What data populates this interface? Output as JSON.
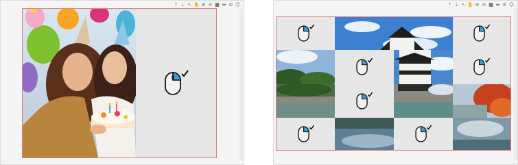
{
  "toolbar_icons": [
    "scroll-up-icon",
    "scroll-down-icon",
    "zoom-cursor-icon",
    "hand-pan-icon",
    "zoom-in-icon",
    "zoom-out-icon",
    "grid-icon",
    "fit-icon",
    "settings-icon",
    "info-icon"
  ],
  "colors": {
    "canvas_border": "#e07b7b",
    "mouse_highlight": "#3aa0d8",
    "panel_bg": "#f4f4f4",
    "canvas_bg": "#e6e6e6"
  },
  "left_panel": {
    "photo": "birthday-photo-two-women-cake-balloons",
    "placeholder_icon": "mouse-click-icon"
  },
  "right_panel": {
    "grid": [
      [
        "mouse-click-icon",
        "castle-photo",
        "castle-photo",
        "mouse-click-icon"
      ],
      [
        "trees-photo",
        "mouse-click-icon",
        "castle-photo",
        "mouse-click-icon"
      ],
      [
        "trees-photo",
        "mouse-click-icon",
        "castle-photo",
        "autumn-photo"
      ],
      [
        "mouse-click-icon",
        "water-photo",
        "mouse-click-icon",
        "water-photo"
      ]
    ]
  }
}
